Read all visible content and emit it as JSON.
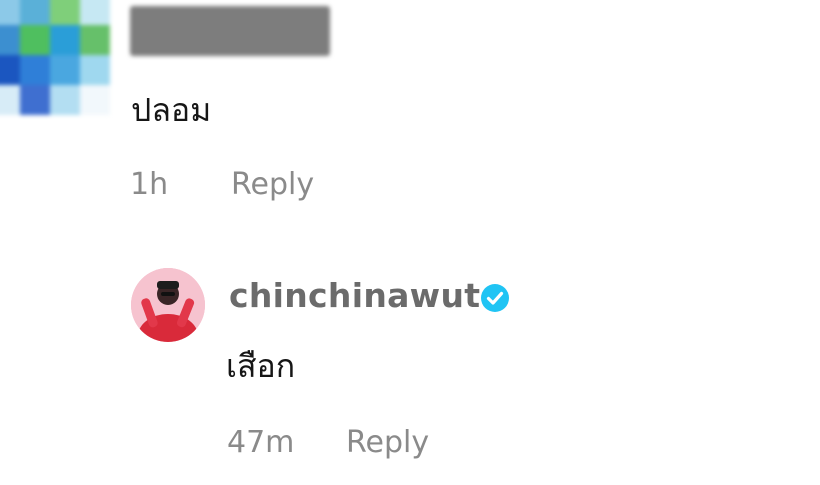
{
  "comments": [
    {
      "text": "ปลอม",
      "time": "1h",
      "reply_label": "Reply"
    },
    {
      "author": "chinchinawut",
      "verified": true,
      "text": "เสือก",
      "time": "47m",
      "reply_label": "Reply"
    }
  ],
  "colors": {
    "text": "#161616",
    "meta": "#8a8a8a",
    "author": "#6b6b6b",
    "verified": "#20c4f4"
  }
}
